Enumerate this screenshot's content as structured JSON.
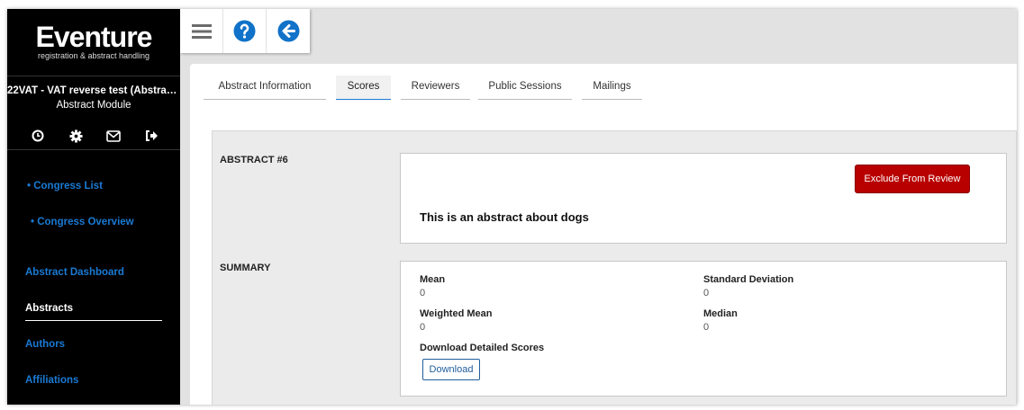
{
  "app": {
    "logo_main": "Eventure",
    "logo_sub": "registration & abstract handling"
  },
  "sidebar": {
    "congress_name": "22VAT - VAT reverse test (Abstract Module)",
    "module_name": "Abstract Module",
    "icons": [
      "history-icon",
      "gear-icon",
      "mail-icon",
      "logout-icon"
    ],
    "links": [
      {
        "label": "• Congress List"
      },
      {
        "label": "• Congress Overview"
      },
      {
        "label": "Abstract Dashboard"
      },
      {
        "label": "Abstracts"
      },
      {
        "label": "Authors"
      },
      {
        "label": "Affiliations"
      }
    ],
    "active_link": "Abstracts"
  },
  "toolbar": {
    "icons": [
      "menu-icon",
      "help-icon",
      "back-arrow-icon"
    ]
  },
  "tabs": [
    {
      "label": "Abstract Information"
    },
    {
      "label": "Scores"
    },
    {
      "label": "Reviewers"
    },
    {
      "label": "Public Sessions"
    },
    {
      "label": "Mailings"
    }
  ],
  "active_tab": "Scores",
  "abstract": {
    "heading": "ABSTRACT #6",
    "exclude_button": "Exclude From Review",
    "text": "This is an abstract about dogs"
  },
  "summary": {
    "heading": "SUMMARY",
    "mean_label": "Mean",
    "mean_value": "0",
    "std_label": "Standard Deviation",
    "std_value": "0",
    "weighted_mean_label": "Weighted Mean",
    "weighted_mean_value": "0",
    "median_label": "Median",
    "median_value": "0",
    "download_label": "Download Detailed Scores",
    "download_button": "Download"
  },
  "colors": {
    "accent": "#1a7ad4",
    "danger": "#b80000",
    "sidebar_bg": "#000000"
  }
}
